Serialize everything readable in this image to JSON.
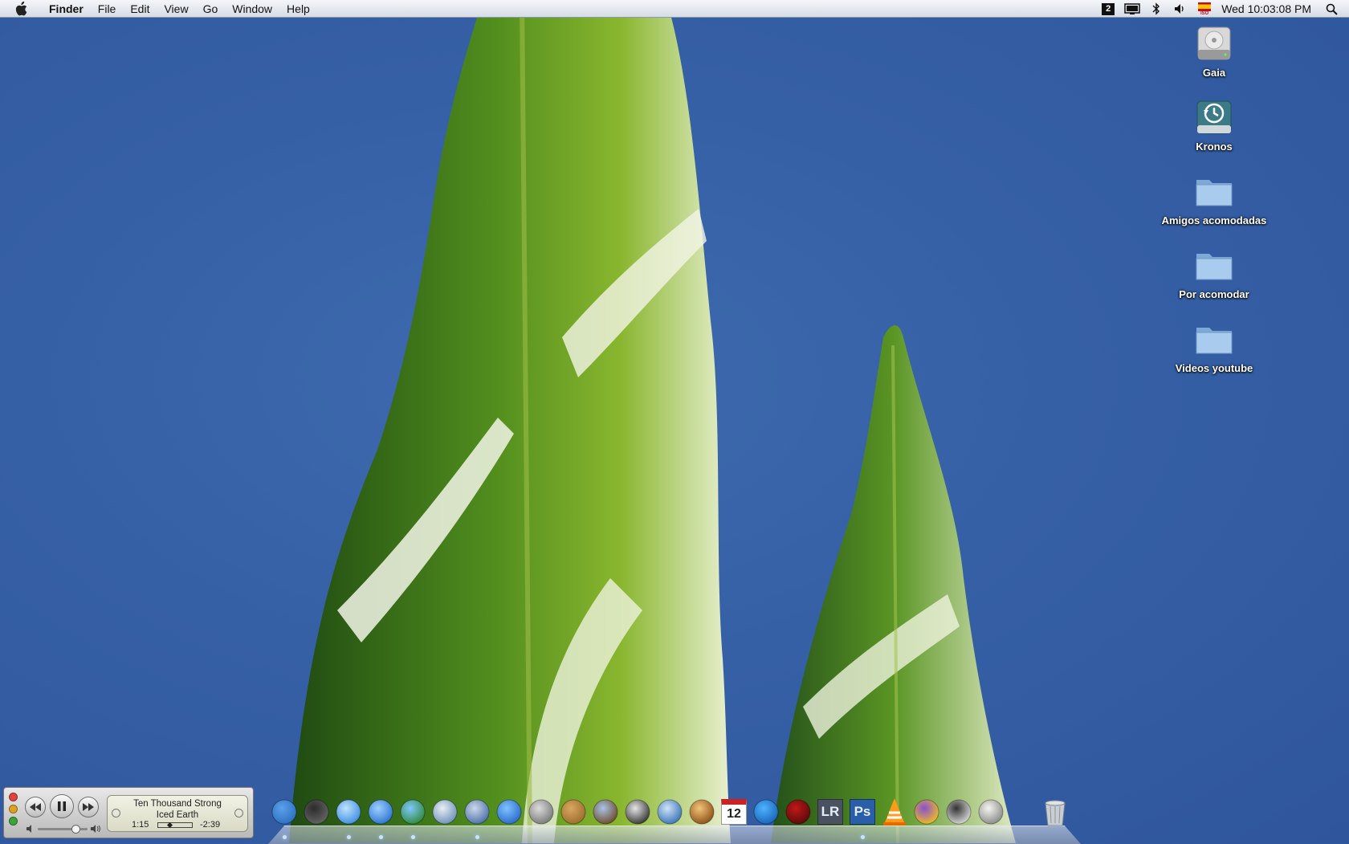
{
  "menubar": {
    "apple_icon": "apple-logo-icon",
    "items": [
      "Finder",
      "File",
      "Edit",
      "View",
      "Go",
      "Window",
      "Help"
    ],
    "status_icons": [
      "spaces-2-icon",
      "display-icon",
      "bluetooth-icon",
      "volume-icon",
      "input-flag-icon",
      "spotlight-search-icon"
    ],
    "spaces_number": "2",
    "flag_label": "ISO",
    "clock": "Wed 10:03:08 PM"
  },
  "desktop": {
    "icons": [
      {
        "label": "Gaia",
        "icon": "hard-drive-icon"
      },
      {
        "label": "Kronos",
        "icon": "time-machine-drive-icon"
      },
      {
        "label": "Amigos acomodadas",
        "icon": "folder-icon"
      },
      {
        "label": "Por acomodar",
        "icon": "folder-icon"
      },
      {
        "label": "Videos youtube",
        "icon": "folder-icon"
      }
    ]
  },
  "mini_player": {
    "track": "Ten Thousand Strong",
    "artist": "Iced Earth",
    "elapsed": "1:15",
    "remaining": "-2:39",
    "progress": 0.32,
    "volume": 0.8,
    "colors": {
      "close": "#e0443e",
      "minimize": "#dea123",
      "zoom": "#3ca33a"
    }
  },
  "dock": {
    "apps": [
      "finder-icon",
      "dashboard-icon",
      "itunes-icon",
      "safari-icon",
      "messenger-icon",
      "preview-icon",
      "mail-stamp-icon",
      "ichat-icon",
      "screenshot-icon",
      "address-book-icon",
      "iphoto-icon",
      "imovie-icon",
      "idvd-icon",
      "garageband-icon",
      "ical-icon",
      "quicktime-icon",
      "photo-booth-icon",
      "lightroom-icon",
      "photoshop-icon",
      "vlc-icon",
      "dvd-app-icon",
      "clapperboard-icon",
      "textedit-icon"
    ],
    "ical_day": "12",
    "lightroom_label": "LR",
    "photoshop_label": "Ps",
    "running_indices": [
      0,
      2,
      3,
      4,
      6,
      18
    ],
    "trash": "trash-icon"
  }
}
